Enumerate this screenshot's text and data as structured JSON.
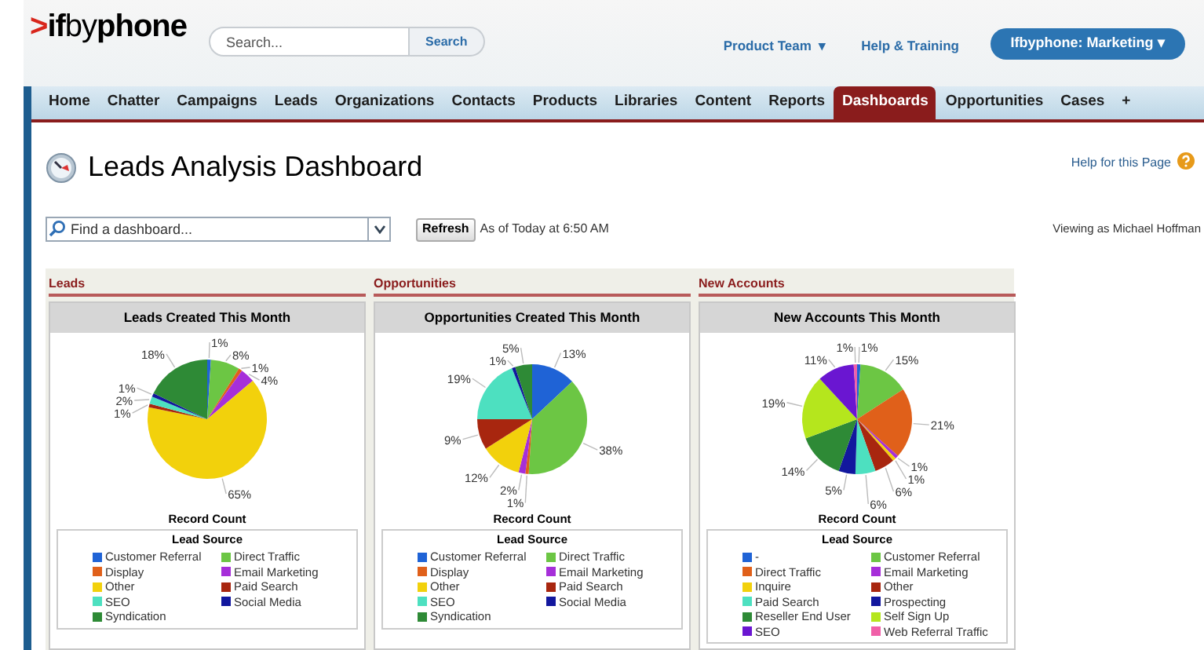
{
  "header": {
    "logo": {
      "mark": ">",
      "text": "**if**by**phone**"
    },
    "search": {
      "placeholder": "Search...",
      "button": "Search"
    },
    "links": [
      {
        "label": "Product Team",
        "caret": "▾"
      },
      {
        "label": "Help & Training"
      }
    ],
    "account_button": {
      "label": "Ifbyphone: Marketing",
      "caret": "▾"
    }
  },
  "tabs": [
    {
      "label": "Home",
      "selected": false
    },
    {
      "label": "Chatter",
      "selected": false
    },
    {
      "label": "Campaigns",
      "selected": false
    },
    {
      "label": "Leads",
      "selected": false
    },
    {
      "label": "Organizations",
      "selected": false
    },
    {
      "label": "Contacts",
      "selected": false
    },
    {
      "label": "Products",
      "selected": false
    },
    {
      "label": "Libraries",
      "selected": false
    },
    {
      "label": "Content",
      "selected": false
    },
    {
      "label": "Reports",
      "selected": false
    },
    {
      "label": "Dashboards",
      "selected": true
    },
    {
      "label": "Opportunities",
      "selected": false
    },
    {
      "label": "Cases",
      "selected": false
    },
    {
      "label": "+",
      "selected": false
    }
  ],
  "page": {
    "title": "Leads Analysis Dashboard",
    "help_link": "Help for this Page",
    "finder": {
      "placeholder": "Find a dashboard..."
    },
    "refresh_button": "Refresh",
    "as_of": "As of Today at 6:50 AM",
    "viewing_as": "Viewing as Michael Hoffman"
  },
  "components": [
    {
      "section": "Leads",
      "title": "Leads Created This Month",
      "legend_title": "Lead Source",
      "chart_data": {
        "type": "pie",
        "categories": [
          "Customer Referral",
          "Direct Traffic",
          "Display",
          "Email Marketing",
          "Other",
          "Paid Search",
          "SEO",
          "Social Media",
          "Syndication"
        ],
        "series": [
          {
            "name": "Record Count",
            "values": [
              1,
              8,
              1,
              4,
              65,
              1,
              2,
              1,
              18
            ]
          }
        ],
        "value_labels": [
          "1%",
          "8%",
          "1%",
          "4%",
          "65%",
          "1%",
          "2%",
          "1%",
          "18%"
        ]
      },
      "legend": [
        {
          "color": "#1f63d6"
        },
        {
          "color": "#6cc644"
        },
        {
          "color": "#e0601a"
        },
        {
          "color": "#a62fd9"
        },
        {
          "color": "#f2d10c"
        },
        {
          "color": "#a8260f"
        },
        {
          "color": "#4de0c0"
        },
        {
          "color": "#12179e"
        },
        {
          "color": "#2e8a36"
        }
      ]
    },
    {
      "section": "Opportunities",
      "title": "Opportunities Created This Month",
      "legend_title": "Lead Source",
      "chart_data": {
        "type": "pie",
        "categories": [
          "Customer Referral",
          "Direct Traffic",
          "Display",
          "Email Marketing",
          "Other",
          "Paid Search",
          "SEO",
          "Social Media",
          "Syndication"
        ],
        "series": [
          {
            "name": "Record Count",
            "values": [
              13,
              38,
              1,
              2,
              12,
              9,
              19,
              1,
              5
            ]
          }
        ],
        "value_labels": [
          "13%",
          "38%",
          "1%",
          "2%",
          "12%",
          "9%",
          "19%",
          "1%",
          "5%"
        ]
      },
      "legend": [
        {
          "color": "#1f63d6"
        },
        {
          "color": "#6cc644"
        },
        {
          "color": "#e0601a"
        },
        {
          "color": "#a62fd9"
        },
        {
          "color": "#f2d10c"
        },
        {
          "color": "#a8260f"
        },
        {
          "color": "#4de0c0"
        },
        {
          "color": "#12179e"
        },
        {
          "color": "#2e8a36"
        }
      ]
    },
    {
      "section": "New Accounts",
      "title": "New Accounts This Month",
      "legend_title": "Lead Source",
      "chart_data": {
        "type": "pie",
        "categories": [
          "-",
          "Customer Referral",
          "Direct Traffic",
          "Email Marketing",
          "Inquire",
          "Other",
          "Paid Search",
          "Prospecting",
          "Reseller End User",
          "Self Sign Up",
          "SEO",
          "Web Referral Traffic"
        ],
        "series": [
          {
            "name": "Record Count",
            "values": [
              1,
              15,
              21,
              1,
              1,
              6,
              6,
              5,
              14,
              19,
              11,
              1
            ]
          }
        ],
        "value_labels": [
          "1%",
          "15%",
          "21%",
          "1%",
          "1%",
          "6%",
          "6%",
          "5%",
          "14%",
          "19%",
          "11%",
          "1%"
        ]
      },
      "legend": [
        {
          "color": "#1f63d6"
        },
        {
          "color": "#6cc644"
        },
        {
          "color": "#e0601a"
        },
        {
          "color": "#a62fd9"
        },
        {
          "color": "#f2d10c"
        },
        {
          "color": "#a8260f"
        },
        {
          "color": "#4de0c0"
        },
        {
          "color": "#12179e"
        },
        {
          "color": "#2e8a36"
        },
        {
          "color": "#b5e61d"
        },
        {
          "color": "#6a16d1"
        },
        {
          "color": "#f060a8"
        }
      ]
    }
  ]
}
